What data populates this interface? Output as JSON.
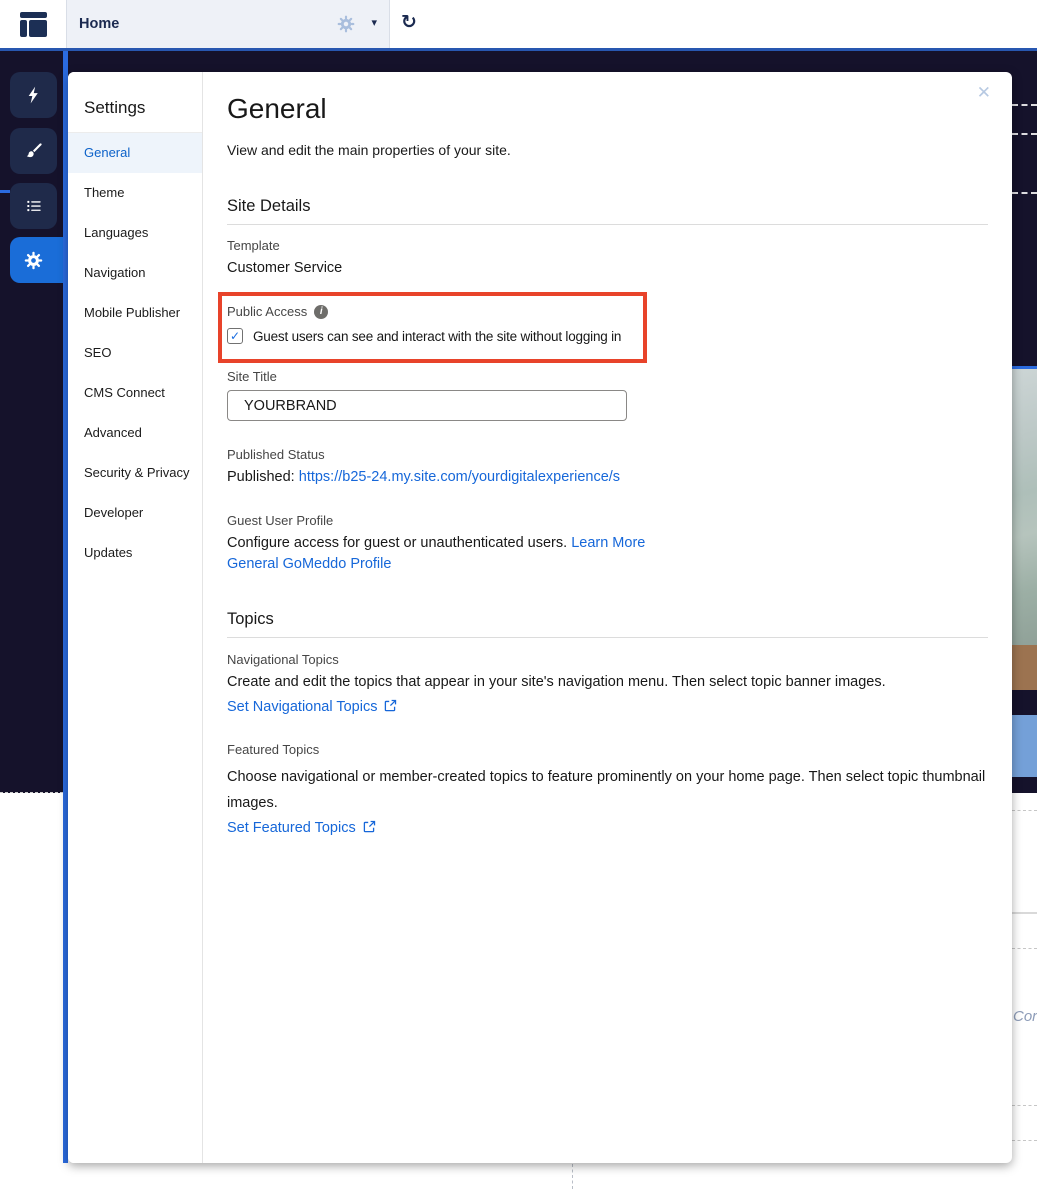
{
  "colors": {
    "accent_blue": "#2b6be0",
    "active_tile_blue": "#1a6dd8",
    "link_blue": "#1667d9",
    "highlight_red": "#e8432a",
    "dark_background": "#15122b"
  },
  "glyphs": {
    "check": "✓",
    "close": "✕",
    "caret": "▾",
    "refresh": "↻",
    "info": "i"
  },
  "top_bar": {
    "tab_label": "Home"
  },
  "sidebar": {
    "title": "Settings",
    "items": [
      {
        "label": "General",
        "active": true
      },
      {
        "label": "Theme"
      },
      {
        "label": "Languages"
      },
      {
        "label": "Navigation"
      },
      {
        "label": "Mobile Publisher"
      },
      {
        "label": "SEO"
      },
      {
        "label": "CMS Connect"
      },
      {
        "label": "Advanced"
      },
      {
        "label": "Security & Privacy"
      },
      {
        "label": "Developer"
      },
      {
        "label": "Updates"
      }
    ]
  },
  "panel": {
    "title": "General",
    "description": "View and edit the main properties of your site.",
    "site_details": {
      "heading": "Site Details",
      "template_label": "Template",
      "template_value": "Customer Service",
      "public_access_label": "Public Access",
      "public_access_checked": true,
      "public_access_text": "Guest users can see and interact with the site without logging in",
      "site_title_label": "Site Title",
      "site_title_value": "YOURBRAND",
      "published_label": "Published Status",
      "published_prefix": "Published:",
      "published_url": "https://b25-24.my.site.com/yourdigitalexperience/s",
      "guest_label": "Guest User Profile",
      "guest_text": "Configure access for guest or unauthenticated users.",
      "learn_more_label": "Learn More",
      "guest_profile_link": "General GoMeddo Profile"
    },
    "topics": {
      "heading": "Topics",
      "navigational_label": "Navigational Topics",
      "navigational_text": "Create and edit the topics that appear in your site's navigation menu. Then select topic banner images.",
      "navigational_link": "Set Navigational Topics",
      "featured_label": "Featured Topics",
      "featured_text": "Choose navigational or member-created topics to feature prominently on your home page. Then select topic thumbnail images.",
      "featured_link": "Set Featured Topics"
    }
  },
  "background": {
    "text_fragment": "Cor"
  }
}
